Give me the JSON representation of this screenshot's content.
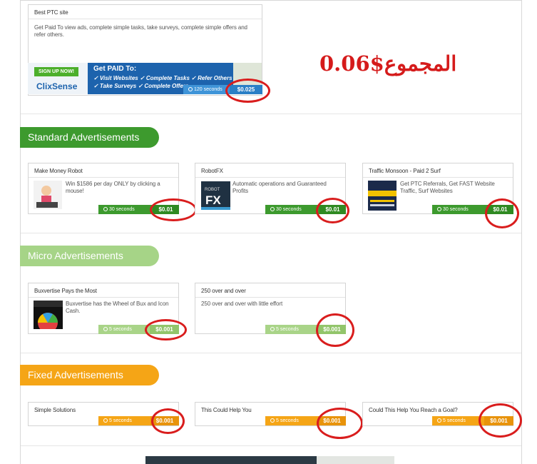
{
  "top_ad": {
    "title": "Best PTC site",
    "description": "Get Paid To view ads, complete simple tasks, take surveys, complete simple offers and refer others.",
    "banner": {
      "signup": "SIGN UP NOW!",
      "brand": "ClixSense",
      "headline": "Get PAID To:",
      "line1": "✓ Visit Websites  ✓ Complete Tasks  ✓ Refer Others",
      "line2": "✓ Take Surveys  ✓ Complete Offers"
    },
    "seconds": "120 seconds",
    "price": "$0.025"
  },
  "total": {
    "label": "المجموع",
    "value": "$0.06"
  },
  "sections": {
    "standard": {
      "title": "Standard Advertisements",
      "ads": [
        {
          "title": "Make Money Robot",
          "description": "Win $1586 per day ONLY by clicking a mouse!",
          "seconds": "30 seconds",
          "price": "$0.01"
        },
        {
          "title": "RobotFX",
          "description": "Automatic operations and Guaranteed Profits",
          "seconds": "30 seconds",
          "price": "$0.01",
          "thumb_text": "ROBOT FX"
        },
        {
          "title": "Traffic Monsoon - Paid 2 Surf",
          "description": "Get PTC Referrals, Get FAST Website Traffic, Surf Websites",
          "seconds": "30 seconds",
          "price": "$0.01"
        }
      ]
    },
    "micro": {
      "title": "Micro Advertisements",
      "ads": [
        {
          "title": "Buxvertise Pays the Most",
          "description": "Buxvertise has the Wheel of Bux and Icon Cash.",
          "seconds": "5 seconds",
          "price": "$0.001"
        },
        {
          "title": "250 over and over",
          "description": "250 over and over with little effort",
          "seconds": "5 seconds",
          "price": "$0.001"
        }
      ]
    },
    "fixed": {
      "title": "Fixed Advertisements",
      "ads": [
        {
          "title": "Simple Solutions",
          "seconds": "5 seconds",
          "price": "$0.001"
        },
        {
          "title": "This Could Help You",
          "seconds": "5 seconds",
          "price": "$0.001"
        },
        {
          "title": "Could This Help You Reach a Goal?",
          "seconds": "5 seconds",
          "price": "$0.001"
        }
      ]
    }
  },
  "colors": {
    "standard": "#3d9a2e",
    "micro": "#a6d487",
    "fixed": "#f5a516",
    "top": "#3f94d8",
    "annotation": "#d91d1d"
  }
}
